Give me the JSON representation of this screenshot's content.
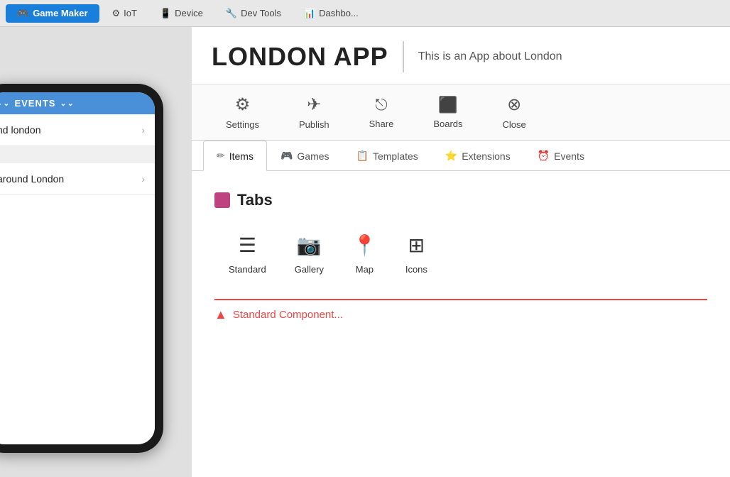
{
  "topnav": {
    "active_btn": "Game Maker",
    "active_icon": "🎮",
    "items": [
      {
        "label": "IoT",
        "icon": "⚙"
      },
      {
        "label": "Device",
        "icon": "📱"
      },
      {
        "label": "Dev Tools",
        "icon": "🔧"
      },
      {
        "label": "Dashbo...",
        "icon": "📊"
      }
    ]
  },
  "phone": {
    "header_label": "EVENTS",
    "list_items": [
      {
        "text": "nd london"
      },
      {
        "text": "around London"
      }
    ]
  },
  "app": {
    "title": "LONDON APP",
    "description": "This is an App about London"
  },
  "toolbar": {
    "items": [
      {
        "label": "Settings",
        "icon": "⚙",
        "name": "settings"
      },
      {
        "label": "Publish",
        "icon": "✈",
        "name": "publish"
      },
      {
        "label": "Share",
        "icon": "↗",
        "name": "share"
      },
      {
        "label": "Boards",
        "icon": "⬛",
        "name": "boards"
      },
      {
        "label": "Close",
        "icon": "✖",
        "name": "close"
      }
    ]
  },
  "subtabs": {
    "items": [
      {
        "label": "Items",
        "icon": "✏",
        "active": true,
        "name": "items"
      },
      {
        "label": "Games",
        "icon": "🎮",
        "active": false,
        "name": "games"
      },
      {
        "label": "Templates",
        "icon": "📋",
        "active": false,
        "name": "templates"
      },
      {
        "label": "Extensions",
        "icon": "⭐",
        "active": false,
        "name": "extensions"
      },
      {
        "label": "Events",
        "icon": "⏰",
        "active": false,
        "name": "events"
      }
    ]
  },
  "items_section": {
    "tabs_header": "Tabs",
    "tabs_color": "#c0417f",
    "tab_types": [
      {
        "label": "Standard",
        "icon": "☰",
        "name": "standard"
      },
      {
        "label": "Gallery",
        "icon": "📷",
        "name": "gallery"
      },
      {
        "label": "Map",
        "icon": "📍",
        "name": "map"
      },
      {
        "label": "Icons",
        "icon": "⊞",
        "name": "icons"
      }
    ],
    "component_hint": "Standard Component..."
  }
}
